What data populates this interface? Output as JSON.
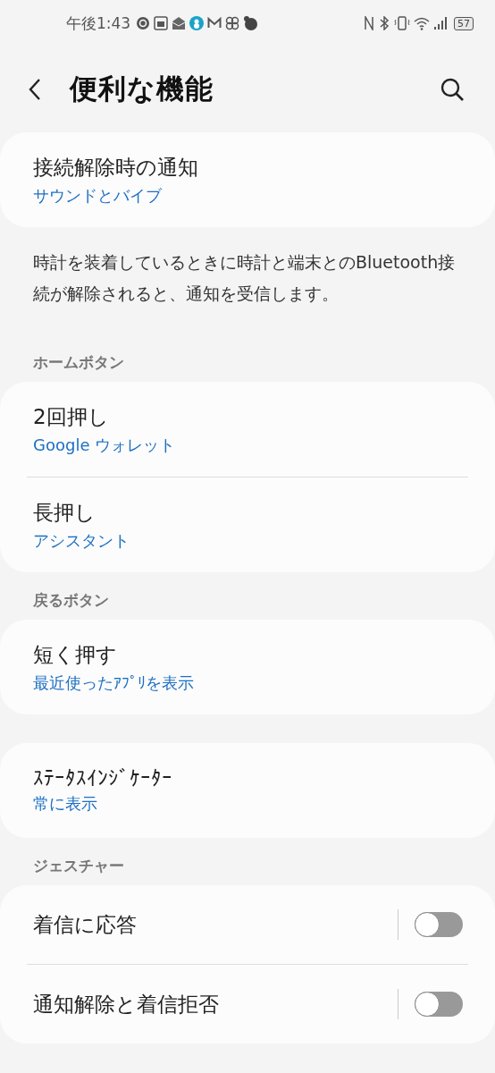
{
  "status_bar": {
    "time": "午後1:43",
    "battery": "57"
  },
  "header": {
    "title": "便利な機能"
  },
  "blocks": [
    {
      "kind": "card",
      "items": [
        {
          "kind": "link",
          "title": "接続解除時の通知",
          "subtitle": "サウンドとバイブ"
        }
      ]
    },
    {
      "kind": "description",
      "text": "時計を装着しているときに時計と端末とのBluetooth接続が解除されると、通知を受信します。"
    },
    {
      "kind": "heading",
      "text": "ホームボタン"
    },
    {
      "kind": "card",
      "items": [
        {
          "kind": "link",
          "title": "2回押し",
          "subtitle": "Google ウォレット"
        },
        {
          "kind": "link",
          "title": "長押し",
          "subtitle": "アシスタント"
        }
      ]
    },
    {
      "kind": "heading",
      "text": "戻るボタン"
    },
    {
      "kind": "card",
      "items": [
        {
          "kind": "link",
          "title": "短く押す",
          "subtitle": "最近使ったｱﾌﾟﾘを表示"
        }
      ]
    },
    {
      "kind": "card",
      "items": [
        {
          "kind": "link",
          "title": "ｽﾃｰﾀｽｲﾝｼﾞｹｰﾀｰ",
          "subtitle": "常に表示"
        }
      ]
    },
    {
      "kind": "heading",
      "text": "ジェスチャー"
    },
    {
      "kind": "card",
      "items": [
        {
          "kind": "switch",
          "title": "着信に応答",
          "on": false
        },
        {
          "kind": "switch",
          "title": "通知解除と着信拒否",
          "on": false
        }
      ]
    }
  ]
}
